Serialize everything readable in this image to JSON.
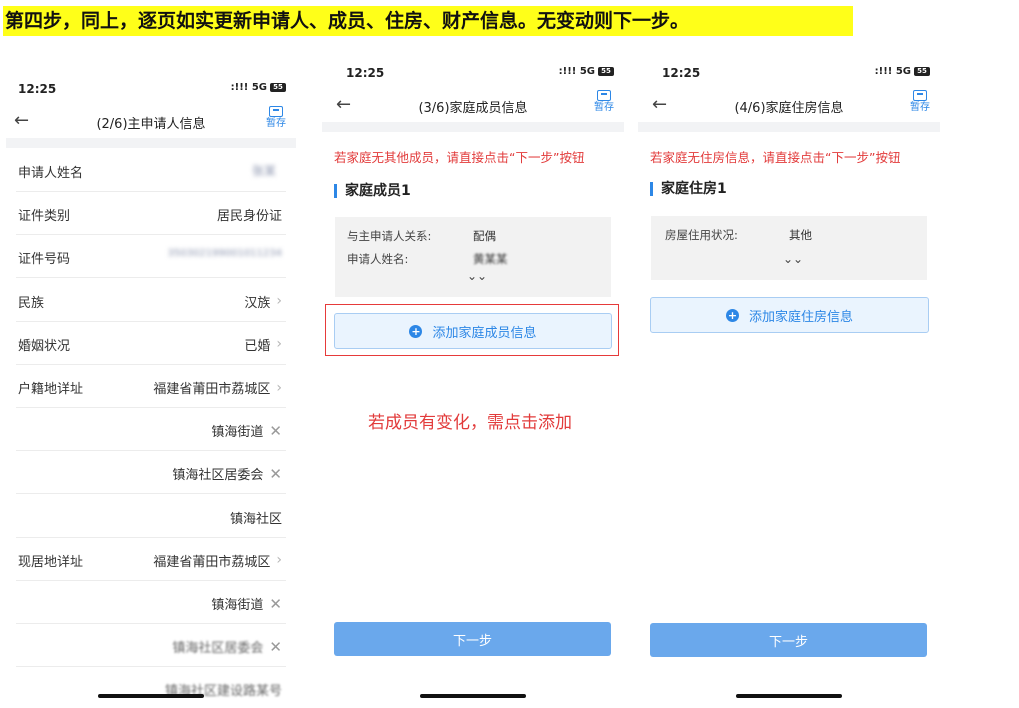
{
  "banner": "第四步，同上，逐页如实更新申请人、成员、住房、财产信息。无变动则下一步。",
  "status": {
    "time": "12:25",
    "signal": ":!!! 5G",
    "battery": "55"
  },
  "common": {
    "save_label": "暂存",
    "back_icon": "arrow-left-icon",
    "next_label": "下一步"
  },
  "phone1": {
    "title": "(2/6)主申请人信息",
    "rows": [
      {
        "label": "申请人姓名",
        "value": "张某"
      },
      {
        "label": "证件类别",
        "value": "居民身份证"
      },
      {
        "label": "证件号码",
        "value": "350302199001011234"
      },
      {
        "label": "民族",
        "value": "汉族",
        "trail": "›"
      },
      {
        "label": "婚姻状况",
        "value": "已婚",
        "trail": "›"
      },
      {
        "label": "户籍地详址",
        "value": "福建省莆田市荔城区",
        "trail": "›"
      },
      {
        "label": "",
        "value": "镇海街道",
        "trail": "✕"
      },
      {
        "label": "",
        "value": "镇海社区居委会",
        "trail": "✕"
      },
      {
        "label": "",
        "value": "镇海社区"
      },
      {
        "label": "现居地详址",
        "value": "福建省莆田市荔城区",
        "trail": "›"
      },
      {
        "label": "",
        "value": "镇海街道",
        "trail": "✕"
      },
      {
        "label": "",
        "value": "镇海社区居委会",
        "trail": "✕"
      },
      {
        "label": "",
        "value": "镇海社区建设路某号"
      }
    ]
  },
  "phone2": {
    "title": "(3/6)家庭成员信息",
    "notice": "若家庭无其他成员，请直接点击“下一步”按钮",
    "section": "家庭成员1",
    "fields": [
      {
        "key": "与主申请人关系:",
        "value": "配偶"
      },
      {
        "key": "申请人姓名:",
        "value": "黄某某"
      }
    ],
    "expand": "⌄⌄",
    "add_label": "添加家庭成员信息",
    "annotation": "若成员有变化，需点击添加"
  },
  "phone3": {
    "title": "(4/6)家庭住房信息",
    "notice": "若家庭无住房信息，请直接点击“下一步”按钮",
    "section": "家庭住房1",
    "fields": [
      {
        "key": "房屋住用状况:",
        "value": "其他"
      }
    ],
    "expand": "⌄⌄",
    "add_label": "添加家庭住房信息"
  }
}
